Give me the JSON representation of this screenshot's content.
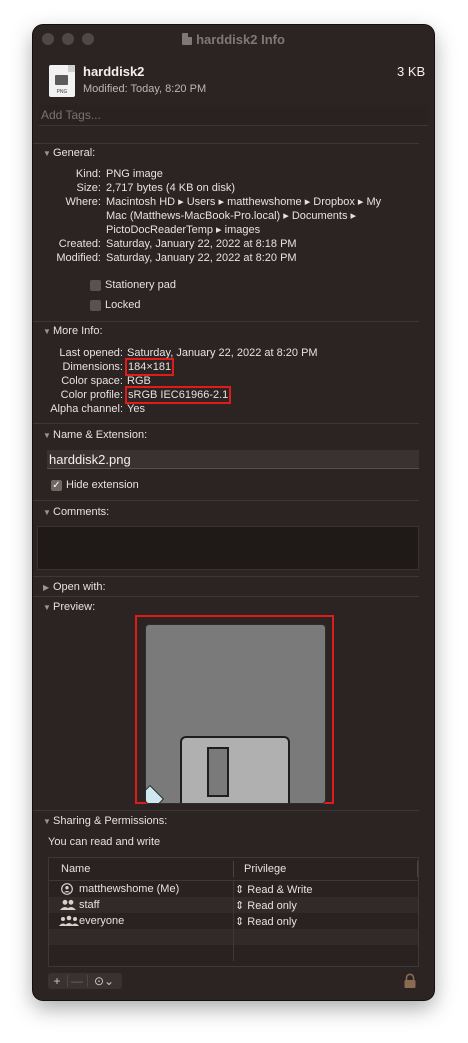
{
  "window": {
    "title": "harddisk2 Info"
  },
  "header": {
    "file_name": "harddisk2",
    "file_size": "3 KB",
    "modified_line": "Modified: Today, 8:20 PM",
    "icon_label": "PNG"
  },
  "tags": {
    "placeholder": "Add Tags..."
  },
  "general": {
    "title": "General:",
    "rows": [
      {
        "key": "Kind:",
        "value": "PNG image"
      },
      {
        "key": "Size:",
        "value": "2,717 bytes (4 KB on disk)"
      },
      {
        "key": "Where:",
        "value_lines": [
          "Macintosh HD ▸ Users ▸ matthewshome ▸ Dropbox ▸ My",
          "Mac (Matthews-MacBook-Pro.local) ▸ Documents ▸",
          "PictoDocReaderTemp ▸ images"
        ]
      },
      {
        "key": "Created:",
        "value": "Saturday, January 22, 2022 at 8:18 PM"
      },
      {
        "key": "Modified:",
        "value": "Saturday, January 22, 2022 at 8:20 PM"
      }
    ],
    "stationery_label": "Stationery pad",
    "locked_label": "Locked"
  },
  "more_info": {
    "title": "More Info:",
    "rows": [
      {
        "key": "Last opened:",
        "value": "Saturday, January 22, 2022 at 8:20 PM"
      },
      {
        "key": "Dimensions:",
        "value": "184×181"
      },
      {
        "key": "Color space:",
        "value": "RGB"
      },
      {
        "key": "Color profile:",
        "value": "sRGB IEC61966-2.1"
      },
      {
        "key": "Alpha channel:",
        "value": "Yes"
      }
    ]
  },
  "name_extension": {
    "title": "Name & Extension:",
    "name_value": "harddisk2.png",
    "hide_extension_label": "Hide extension",
    "hide_extension_checked": true
  },
  "comments": {
    "title": "Comments:"
  },
  "open_with": {
    "title": "Open with:"
  },
  "preview": {
    "title": "Preview:"
  },
  "sharing": {
    "title": "Sharing & Permissions:",
    "status": "You can read and write",
    "columns": [
      "Name",
      "Privilege"
    ],
    "rows": [
      {
        "name": "matthewshome (Me)",
        "privilege": "Read & Write",
        "icon": "single-user-icon"
      },
      {
        "name": "staff",
        "privilege": "Read only",
        "icon": "group-icon"
      },
      {
        "name": "everyone",
        "privilege": "Read only",
        "icon": "everyone-icon"
      }
    ]
  },
  "footer": {
    "add_label": "+",
    "remove_label": "—",
    "action_label": "⊙⌄"
  },
  "colors": {
    "window_bg": "#2c2422",
    "highlight": "#e01b1b"
  }
}
